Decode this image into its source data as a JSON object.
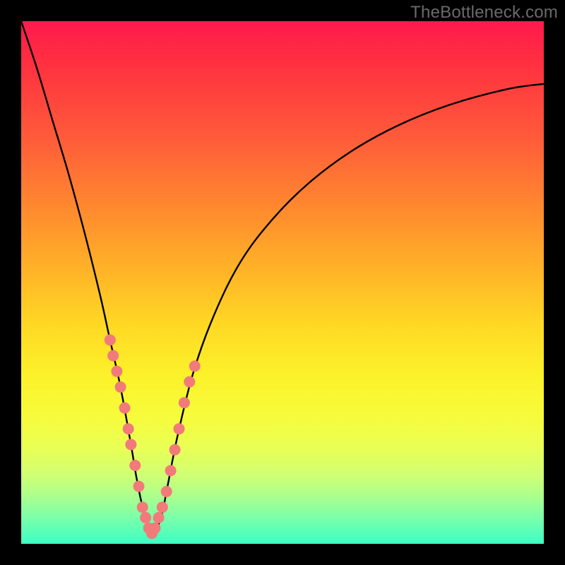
{
  "watermark": {
    "text": "TheBottleneck.com"
  },
  "colors": {
    "background": "#000000",
    "curve": "#000000",
    "marker": "#f27a7a",
    "gradient_top": "#ff1a4d",
    "gradient_bottom": "#3cffc4"
  },
  "chart_data": {
    "type": "line",
    "title": "",
    "xlabel": "",
    "ylabel": "",
    "xlim": [
      0,
      100
    ],
    "ylim": [
      0,
      100
    ],
    "grid": false,
    "legend": false,
    "series": [
      {
        "name": "bottleneck-curve",
        "x": [
          0,
          3,
          6,
          9,
          12,
          15,
          17,
          19,
          21,
          22,
          23,
          24,
          25,
          26,
          27,
          28,
          30,
          33,
          37,
          42,
          48,
          55,
          63,
          72,
          82,
          93,
          100
        ],
        "y": [
          100,
          91,
          81,
          71,
          60,
          48,
          39,
          30,
          19,
          13,
          8,
          4,
          2,
          3,
          6,
          11,
          21,
          33,
          44,
          54,
          62,
          69,
          75,
          80,
          84,
          87,
          88
        ]
      }
    ],
    "marker_clusters": [
      {
        "name": "left-arm-markers",
        "points": [
          {
            "x": 17.0,
            "y": 39
          },
          {
            "x": 17.6,
            "y": 36
          },
          {
            "x": 18.3,
            "y": 33
          },
          {
            "x": 19.0,
            "y": 30
          },
          {
            "x": 19.8,
            "y": 26
          },
          {
            "x": 20.5,
            "y": 22
          },
          {
            "x": 21.0,
            "y": 19
          },
          {
            "x": 21.8,
            "y": 15
          },
          {
            "x": 22.5,
            "y": 11
          },
          {
            "x": 23.2,
            "y": 7
          },
          {
            "x": 23.8,
            "y": 5
          },
          {
            "x": 24.4,
            "y": 3
          },
          {
            "x": 25.0,
            "y": 2
          }
        ]
      },
      {
        "name": "right-arm-markers",
        "points": [
          {
            "x": 25.6,
            "y": 3
          },
          {
            "x": 26.3,
            "y": 5
          },
          {
            "x": 27.0,
            "y": 7
          },
          {
            "x": 27.8,
            "y": 10
          },
          {
            "x": 28.6,
            "y": 14
          },
          {
            "x": 29.4,
            "y": 18
          },
          {
            "x": 30.2,
            "y": 22
          },
          {
            "x": 31.2,
            "y": 27
          },
          {
            "x": 32.2,
            "y": 31
          },
          {
            "x": 33.2,
            "y": 34
          }
        ]
      }
    ]
  }
}
